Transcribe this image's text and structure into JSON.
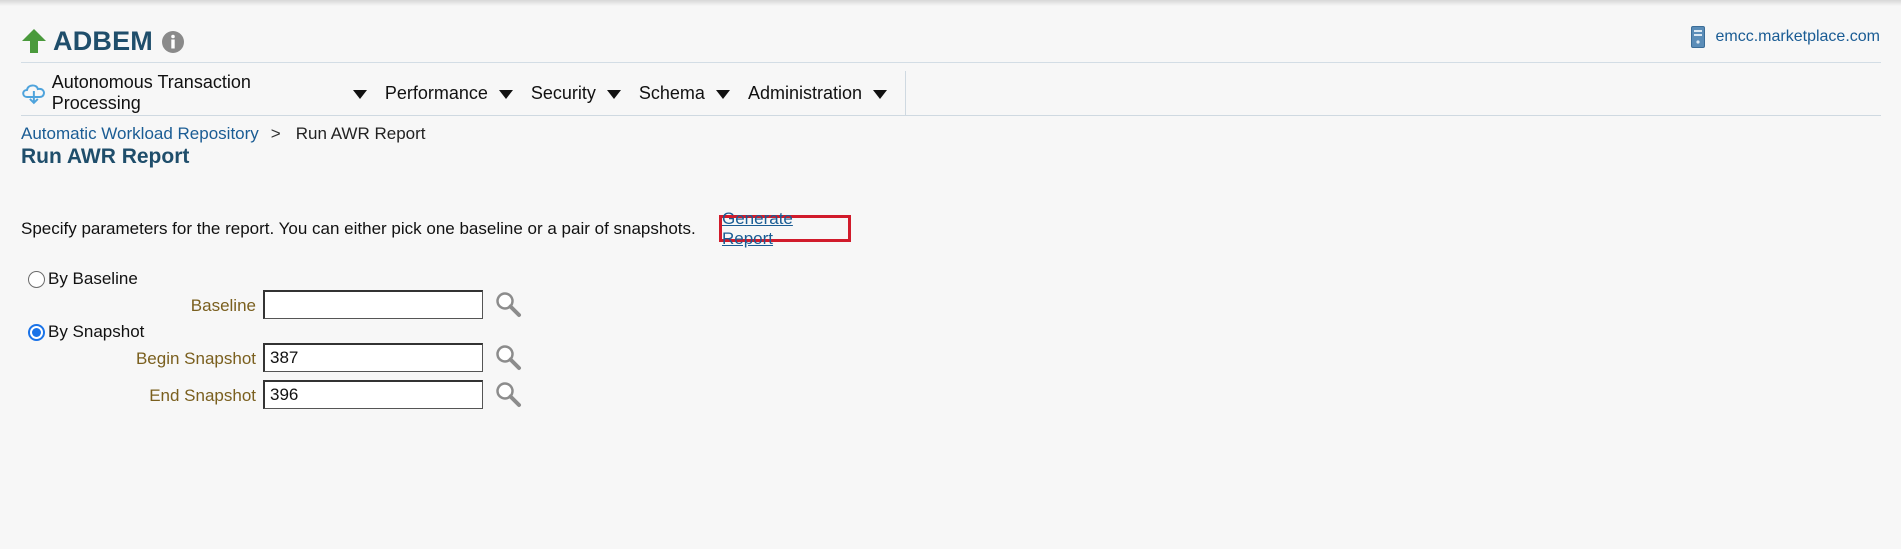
{
  "header": {
    "target_name": "ADBEM",
    "host": "emcc.marketplace.com"
  },
  "nav": {
    "items": [
      {
        "label": "Autonomous Transaction Processing"
      },
      {
        "label": "Performance"
      },
      {
        "label": "Security"
      },
      {
        "label": "Schema"
      },
      {
        "label": "Administration"
      }
    ]
  },
  "breadcrumb": {
    "parent": "Automatic Workload Repository",
    "separator": ">",
    "current": "Run AWR Report"
  },
  "page": {
    "title": "Run AWR Report",
    "description": "Specify parameters for the report. You can either pick one baseline or a pair of snapshots.",
    "generate_button": "Generate Report"
  },
  "form": {
    "by_baseline_label": "By Baseline",
    "by_baseline_selected": false,
    "baseline_label": "Baseline",
    "baseline_value": "",
    "by_snapshot_label": "By Snapshot",
    "by_snapshot_selected": true,
    "begin_snapshot_label": "Begin Snapshot",
    "begin_snapshot_value": "387",
    "end_snapshot_label": "End Snapshot",
    "end_snapshot_value": "396"
  },
  "icons": {
    "target_status": "green-up-arrow-icon",
    "info": "info-icon",
    "host": "server-icon",
    "nav_menu": "cloud-icon",
    "lookup": "search-icon"
  },
  "colors": {
    "title": "#1f4e6b",
    "link": "#1a5c94",
    "highlight_border": "#d11b2b",
    "field_label": "#7a5f1e",
    "status_up": "#4a9a3c"
  }
}
